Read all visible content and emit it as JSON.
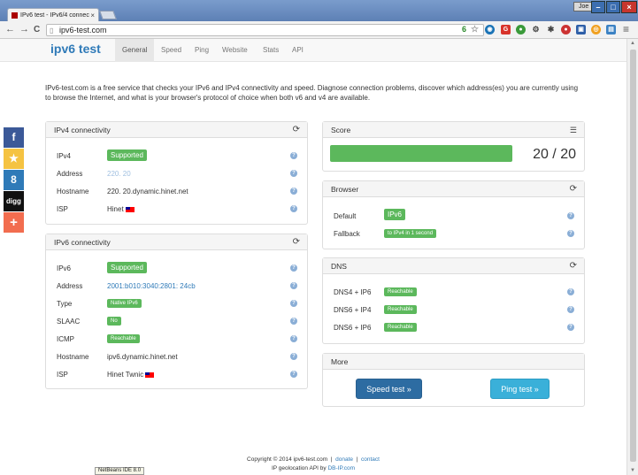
{
  "window": {
    "tab_title": "IPv6 test - IPv6/4 connec",
    "tab_close": "×",
    "user": "Joe",
    "min": "–",
    "max": "□",
    "close": "×"
  },
  "browser": {
    "back": "←",
    "forward": "→",
    "reload": "C",
    "url": "ipv6-test.com",
    "ext_badge": "6",
    "menu": "≡"
  },
  "nav": {
    "brand": "ipv6 test",
    "links": [
      "General",
      "Speed",
      "Ping",
      "Website",
      "Stats",
      "API"
    ]
  },
  "intro": "IPv6-test.com is a free service that checks your IPv6 and IPv4 connectivity and speed. Diagnose connection problems, discover which address(es) you are currently using to browse the Internet, and what is your browser's protocol of choice when both v6 and v4 are available.",
  "social": [
    "f",
    "★",
    "8",
    "digg",
    "+"
  ],
  "ipv4": {
    "title": "IPv4 connectivity",
    "rows": [
      {
        "label": "IPv4",
        "value": "Supported"
      },
      {
        "label": "Address",
        "value": "220.      20"
      },
      {
        "label": "Hostname",
        "value": "220.      20.dynamic.hinet.net"
      },
      {
        "label": "ISP",
        "value": "Hinet"
      }
    ]
  },
  "ipv6": {
    "title": "IPv6 connectivity",
    "rows": [
      {
        "label": "IPv6",
        "value": "Supported"
      },
      {
        "label": "Address",
        "value": "2001:b010:3040:2801:        24cb"
      },
      {
        "label": "Type",
        "value": "Native IPv6"
      },
      {
        "label": "SLAAC",
        "value": "No"
      },
      {
        "label": "ICMP",
        "value": "Reachable"
      },
      {
        "label": "Hostname",
        "value": "ipv6.dynamic.hinet.net"
      },
      {
        "label": "ISP",
        "value": "Hinet Twnic"
      }
    ]
  },
  "score": {
    "title": "Score",
    "value": "20 / 20",
    "fraction": 1.0
  },
  "browser_panel": {
    "title": "Browser",
    "rows": [
      {
        "label": "Default",
        "value": "IPv6"
      },
      {
        "label": "Fallback",
        "value": "to IPv4 in 1 second"
      }
    ]
  },
  "dns": {
    "title": "DNS",
    "rows": [
      {
        "label": "DNS4 + IP6",
        "value": "Reachable"
      },
      {
        "label": "DNS6 + IP4",
        "value": "Reachable"
      },
      {
        "label": "DNS6 + IP6",
        "value": "Reachable"
      }
    ]
  },
  "more": {
    "title": "More",
    "speed_button": "Speed test »",
    "ping_button": "Ping test »"
  },
  "footer": {
    "copyright": "Copyright © 2014 ipv6-test.com",
    "sep": "|",
    "donate": "donate",
    "contact": "contact",
    "geo": "IP geolocation API by",
    "geo_link": "DB-IP.com"
  },
  "taskbar_tooltip": "NetBeans IDE 8.0",
  "colors": {
    "accent": "#2f7ab8",
    "success": "#5cb85c"
  }
}
